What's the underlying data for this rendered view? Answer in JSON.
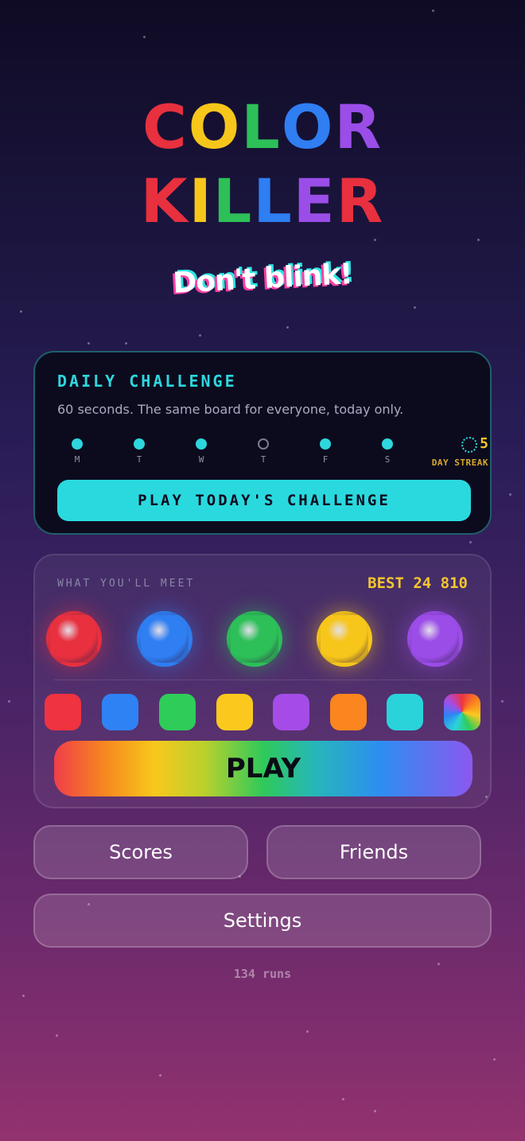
{
  "title": {
    "line1": [
      {
        "ch": "C",
        "color": "#e8303f"
      },
      {
        "ch": "O",
        "color": "#f7c61b"
      },
      {
        "ch": "L",
        "color": "#2dbf58"
      },
      {
        "ch": "O",
        "color": "#2f7ef2"
      },
      {
        "ch": "R",
        "color": "#9b4de8"
      }
    ],
    "line2": [
      {
        "ch": "K",
        "color": "#e8303f"
      },
      {
        "ch": "I",
        "color": "#f7c61b"
      },
      {
        "ch": "L",
        "color": "#2dbf58"
      },
      {
        "ch": "L",
        "color": "#2f7ef2"
      },
      {
        "ch": "E",
        "color": "#9b4de8"
      },
      {
        "ch": "R",
        "color": "#e8303f"
      }
    ]
  },
  "tagline": "Don't blink!",
  "daily": {
    "title": "DAILY CHALLENGE",
    "description": "60 seconds. The same board for everyone, today only.",
    "days": [
      {
        "label": "M",
        "done": true
      },
      {
        "label": "T",
        "done": true
      },
      {
        "label": "W",
        "done": true
      },
      {
        "label": "T",
        "done": false
      },
      {
        "label": "F",
        "done": true
      },
      {
        "label": "S",
        "done": true
      }
    ],
    "streak_value": "5",
    "streak_label": "DAY STREAK",
    "button_label": "PLAY TODAY'S CHALLENGE"
  },
  "meet": {
    "label": "WHAT YOU'LL MEET",
    "best": "BEST 24 810",
    "orbs": [
      "#e8303f",
      "#2f7ef2",
      "#2dbf58",
      "#f7c61b",
      "#9b4de8"
    ],
    "swatches": [
      "#ef3340",
      "#2f82f4",
      "#2fcc5a",
      "#fbc91d",
      "#a54ce8",
      "#fb851f",
      "#2ad3da",
      "rainbow"
    ],
    "play_label": "PLAY"
  },
  "buttons": {
    "scores": "Scores",
    "friends": "Friends",
    "settings": "Settings"
  },
  "runs": "134 runs"
}
